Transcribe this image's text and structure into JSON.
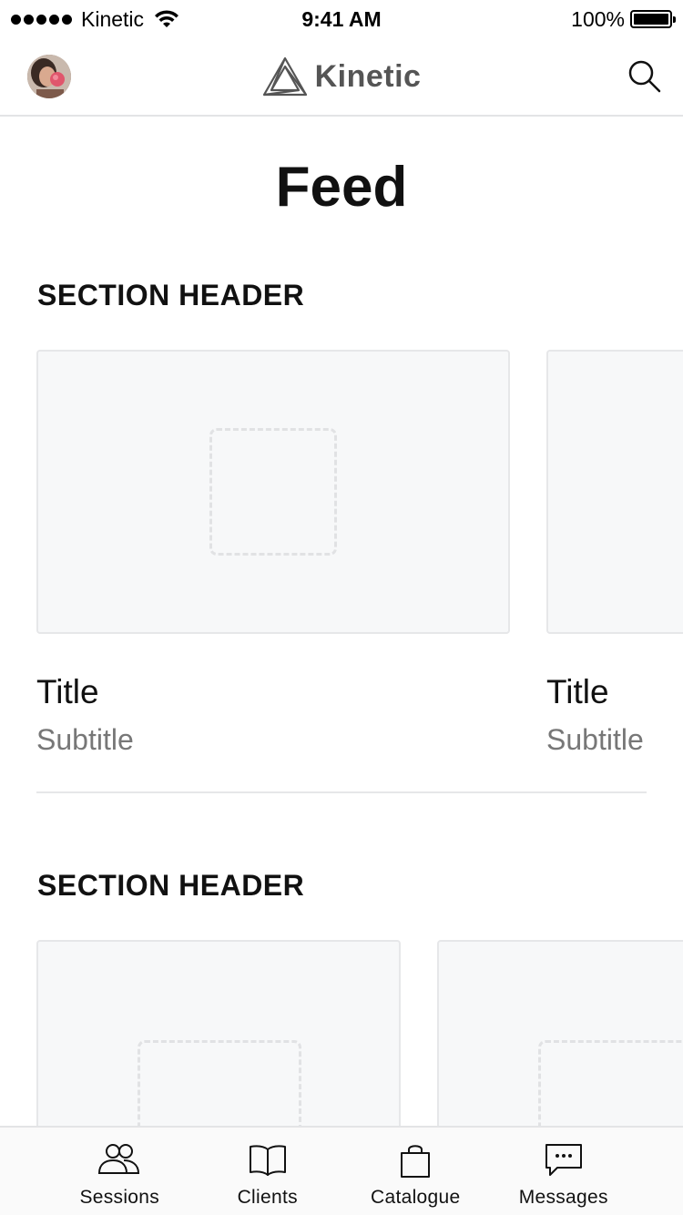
{
  "status_bar": {
    "carrier": "Kinetic",
    "time": "9:41 AM",
    "battery_percent": "100%",
    "battery_level": 1.0
  },
  "nav": {
    "brand": "Kinetic",
    "avatar_icon": "user-avatar",
    "search_icon": "search-icon"
  },
  "page": {
    "title": "Feed"
  },
  "sections": [
    {
      "header": "SECTION HEADER",
      "cards": [
        {
          "title": "Title",
          "subtitle": "Subtitle"
        },
        {
          "title": "Title",
          "subtitle": "Subtitle"
        }
      ]
    },
    {
      "header": "SECTION HEADER",
      "cards": [
        {
          "title": "",
          "subtitle": ""
        },
        {
          "title": "",
          "subtitle": ""
        }
      ]
    }
  ],
  "tab_bar": {
    "items": [
      {
        "label": "Sessions",
        "icon": "people-icon"
      },
      {
        "label": "Clients",
        "icon": "book-icon"
      },
      {
        "label": "Catalogue",
        "icon": "shopping-bag-icon"
      },
      {
        "label": "Messages",
        "icon": "chat-bubble-icon"
      }
    ]
  },
  "colors": {
    "divider": "#e3e4e6",
    "card_background": "#f7f8f9",
    "subtitle": "#777777",
    "logo": "#555555"
  }
}
